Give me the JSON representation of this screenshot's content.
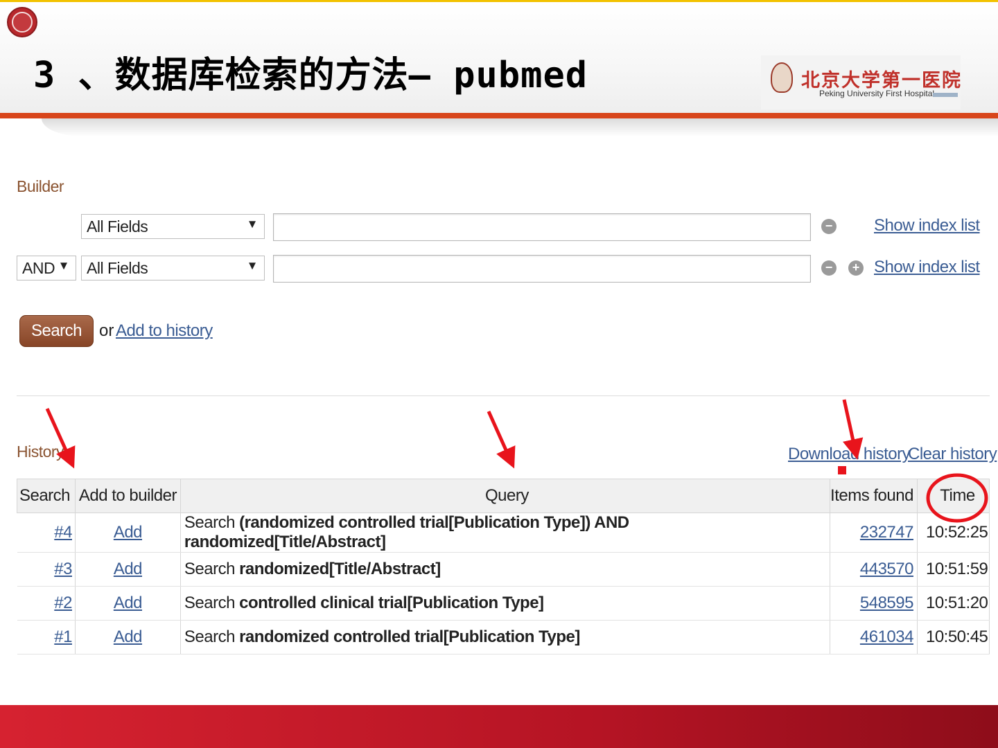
{
  "slide": {
    "title": "3 、数据库检索的方法— pubmed",
    "logo_cn": "北京大学第一医院",
    "logo_en": "Peking University First Hospital"
  },
  "builder": {
    "label": "Builder",
    "rows": [
      {
        "field": "All Fields",
        "value": "",
        "show_index": "Show index list"
      },
      {
        "operator": "AND",
        "field": "All Fields",
        "value": "",
        "show_index": "Show index list"
      }
    ],
    "search_button": "Search",
    "or_text": "or",
    "add_to_history": "Add to history"
  },
  "history": {
    "label": "History",
    "download": "Download history",
    "clear": "Clear history",
    "columns": [
      "Search",
      "Add to builder",
      "Query",
      "Items found",
      "Time"
    ],
    "rows": [
      {
        "num": "#4",
        "add": "Add",
        "prefix": "Search",
        "query": "(randomized controlled trial[Publication Type]) AND randomized[Title/Abstract]",
        "items": "232747",
        "time": "10:52:25"
      },
      {
        "num": "#3",
        "add": "Add",
        "prefix": "Search",
        "query": "randomized[Title/Abstract]",
        "items": "443570",
        "time": "10:51:59"
      },
      {
        "num": "#2",
        "add": "Add",
        "prefix": "Search",
        "query": "controlled clinical trial[Publication Type]",
        "items": "548595",
        "time": "10:51:20"
      },
      {
        "num": "#1",
        "add": "Add",
        "prefix": "Search",
        "query": "randomized controlled trial[Publication Type]",
        "items": "461034",
        "time": "10:50:45"
      }
    ]
  },
  "colors": {
    "accent": "#d8451b",
    "link": "#3a5c93",
    "button": "#874527",
    "annotation": "#e8141c",
    "footer": "#b51424"
  }
}
